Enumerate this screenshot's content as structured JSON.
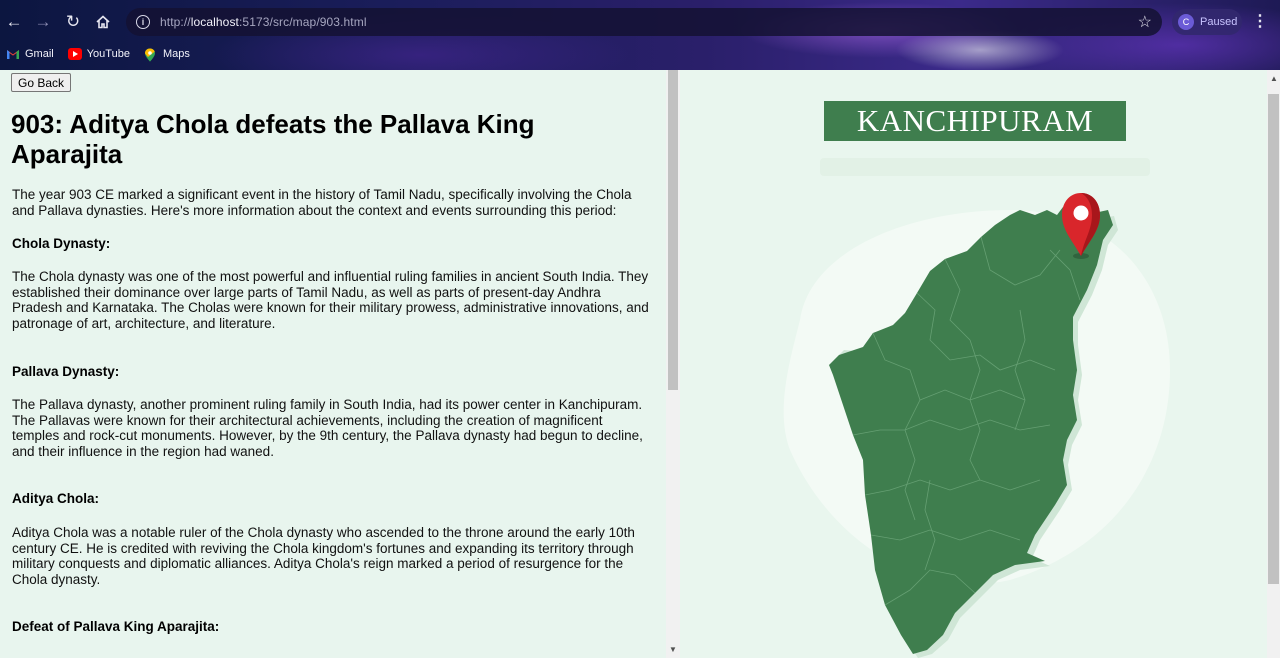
{
  "browser": {
    "url_prefix": "http://",
    "url_host": "localhost",
    "url_rest": ":5173/src/map/903.html",
    "profile_initial": "C",
    "profile_status": "Paused",
    "bookmarks": [
      {
        "label": "Gmail",
        "icon": "gmail-icon"
      },
      {
        "label": "YouTube",
        "icon": "youtube-icon"
      },
      {
        "label": "Maps",
        "icon": "maps-icon"
      }
    ]
  },
  "page": {
    "go_back_label": "Go Back",
    "title": "903: Aditya Chola defeats the Pallava King Aparajita",
    "intro": "The year 903 CE marked a significant event in the history of Tamil Nadu, specifically involving the Chola and Pallava dynasties. Here's more information about the context and events surrounding this period:",
    "sections": [
      {
        "heading": "Chola Dynasty:",
        "text": "The Chola dynasty was one of the most powerful and influential ruling families in ancient South India. They established their dominance over large parts of Tamil Nadu, as well as parts of present-day Andhra Pradesh and Karnataka. The Cholas were known for their military prowess, administrative innovations, and patronage of art, architecture, and literature."
      },
      {
        "heading": "Pallava Dynasty:",
        "text": "The Pallava dynasty, another prominent ruling family in South India, had its power center in Kanchipuram. The Pallavas were known for their architectural achievements, including the creation of magnificent temples and rock-cut monuments. However, by the 9th century, the Pallava dynasty had begun to decline, and their influence in the region had waned."
      },
      {
        "heading": "Aditya Chola:",
        "text": "Aditya Chola was a notable ruler of the Chola dynasty who ascended to the throne around the early 10th century CE. He is credited with reviving the Chola kingdom's fortunes and expanding its territory through military conquests and diplomatic alliances. Aditya Chola's reign marked a period of resurgence for the Chola dynasty."
      },
      {
        "heading": "Defeat of Pallava King Aparajita:",
        "text": ""
      }
    ]
  },
  "map": {
    "banner": "KANCHIPURAM",
    "land_color": "#3f7e4e",
    "pin_color": "#d9262b"
  }
}
